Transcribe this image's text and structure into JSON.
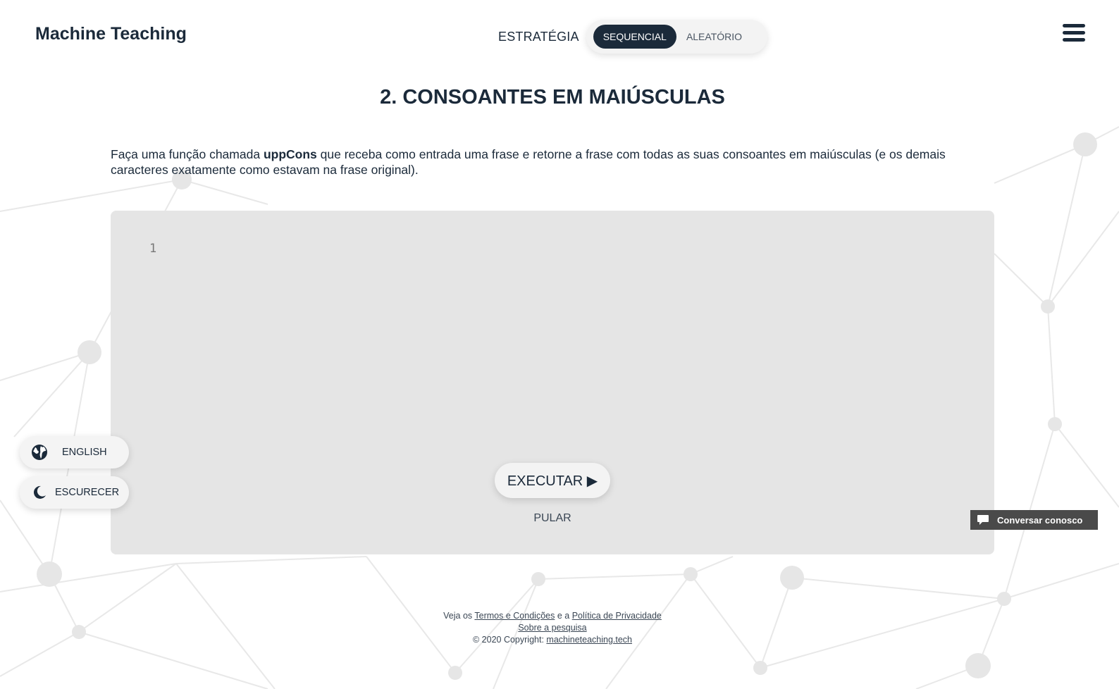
{
  "brand": "Machine Teaching",
  "strategy": {
    "label": "ESTRATÉGIA",
    "options": [
      "SEQUENCIAL",
      "ALEATÓRIO"
    ],
    "selected": "SEQUENCIAL"
  },
  "menu_icon": "hamburger-menu-icon",
  "exercise": {
    "title": "2. CONSOANTES EM MAIÚSCULAS",
    "desc_before": "Faça uma função chamada ",
    "desc_function": "uppCons",
    "desc_after": " que receba como entrada uma frase e retorne a frase com todas as suas consoantes em maiúsculas (e os demais caracteres exatamente como estavam na frase original)."
  },
  "editor": {
    "line_numbers": [
      "1"
    ],
    "code": "",
    "run_label": "EXECUTAR ▶",
    "skip_label": "PULAR"
  },
  "floating": {
    "language_label": "ENGLISH",
    "language_icon": "globe-icon",
    "theme_label": "ESCURECER",
    "theme_icon": "moon-icon"
  },
  "chat": {
    "label": "Conversar conosco",
    "icon": "chat-bubble-icon"
  },
  "footer": {
    "terms_prefix": "Veja os ",
    "terms_link": "Termos e Condições",
    "terms_mid": " e a ",
    "privacy_link": "Política de Privacidade",
    "research_link": "Sobre a pesquisa",
    "copyright_prefix": "© 2020 Copyright: ",
    "copyright_link": "machineteaching.tech"
  },
  "colors": {
    "primary": "#1b2a3a",
    "editor_bg": "#e5e5e5",
    "chat_bg": "#4a4a4a",
    "network_lines": "#e6e6e6"
  }
}
